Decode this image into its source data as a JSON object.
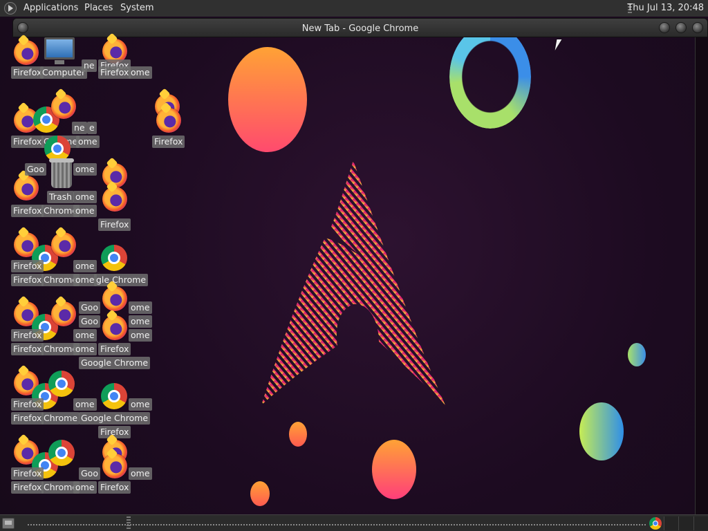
{
  "top_panel": {
    "applications": "Applications",
    "places": "Places",
    "system": "System",
    "clock": "Thu Jul 13, 20:48"
  },
  "window": {
    "title": "New Tab - Google Chrome"
  },
  "desktop_labels": [
    "Firefox",
    "Computer",
    "ne",
    "Firefox",
    "Firefox",
    "ome",
    "Firefox",
    "Chrome",
    "ne",
    "e",
    "ome",
    "Firefox",
    "Goo",
    "ome",
    "Trash",
    "ome",
    "Firefox",
    "Chrome",
    "ome",
    "Firefox",
    "Firefox",
    "ome",
    "Firefox",
    "Chrome",
    "ome",
    "gle Chrome",
    "Goo",
    "ome",
    "Goo",
    "ome",
    "Firefox",
    "ome",
    "ome",
    "Firefox",
    "Chrome",
    "ome",
    "Firefox",
    "Google Chrome",
    "Firefox",
    "ome",
    "ome",
    "Firefox",
    "Chrome",
    "Google Chrome",
    "Firefox",
    "Firefox",
    "Goo",
    "ome",
    "Firefox",
    "Chrome",
    "ome",
    "Firefox"
  ],
  "colors": {
    "panel": "#303030",
    "wallpaper": "#1d0b21",
    "arch_pink": "#e0246f",
    "arch_yellow": "#f7d440",
    "ring_green": "#a8e06a",
    "ring_blue": "#3b8ee8"
  }
}
